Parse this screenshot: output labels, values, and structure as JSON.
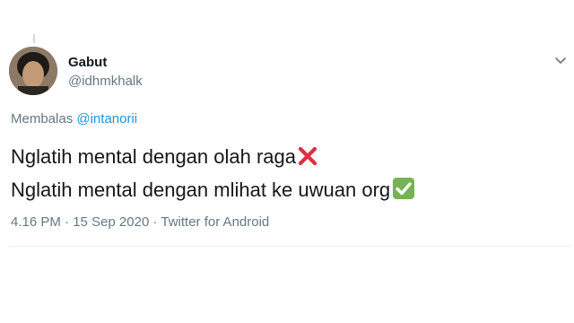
{
  "tweet": {
    "author_name": "Gabut",
    "author_handle": "@idhmkhalk",
    "reply_prefix": "Membalas",
    "reply_mention": "@intanorii",
    "line1": "Nglatih mental dengan olah raga",
    "line1_emoji": "cross-mark",
    "line2": "Nglatih mental dengan mlihat ke uwuan org",
    "line2_emoji": "check-mark-button",
    "time": "4.16 PM",
    "separator": "·",
    "date": "15 Sep 2020",
    "source": "Twitter for Android"
  },
  "colors": {
    "link": "#1b95e0",
    "secondary_text": "#657786",
    "primary_text": "#14171a",
    "cross": "#dd2e44",
    "check_bg": "#77b255"
  },
  "icons": {
    "menu": "chevron-down-icon"
  }
}
